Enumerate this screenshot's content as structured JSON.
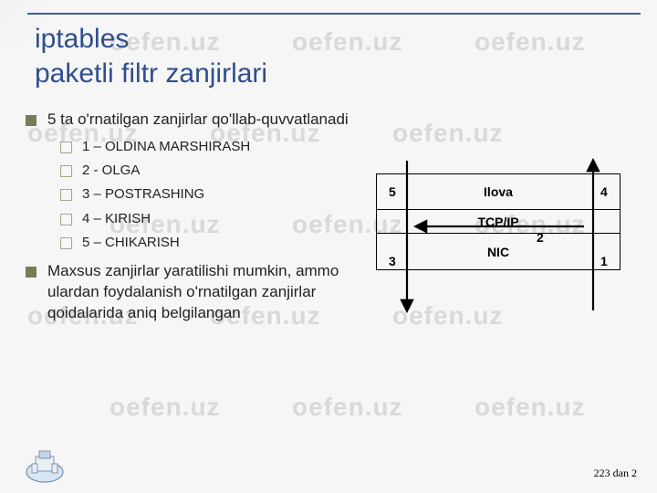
{
  "title_line1": "iptables",
  "title_line2": "paketli filtr zanjirlari",
  "bullets": {
    "b1": "5 ta o'rnatilgan zanjirlar qo'llab-quvvatlanadi",
    "sub": {
      "s1": "1 – OLDINA MARSHIRASH",
      "s2": "2 - OLGA",
      "s3": "3 – POSTRASHING",
      "s4": "4 – KIRISH",
      "s5": "5 – CHIKARISH"
    },
    "b2": "Maxsus zanjirlar yaratilishi mumkin, ammo ulardan foydalanish o'rnatilgan zanjirlar qoidalarida aniq belgilangan"
  },
  "diagram": {
    "row1": "Ilova",
    "row2": "TCP/IP",
    "row3": "NIC",
    "n1": "1",
    "n2": "2",
    "n3": "3",
    "n4": "4",
    "n5": "5"
  },
  "footer": {
    "page": "223 dan 2"
  },
  "watermark": "oefen.uz"
}
